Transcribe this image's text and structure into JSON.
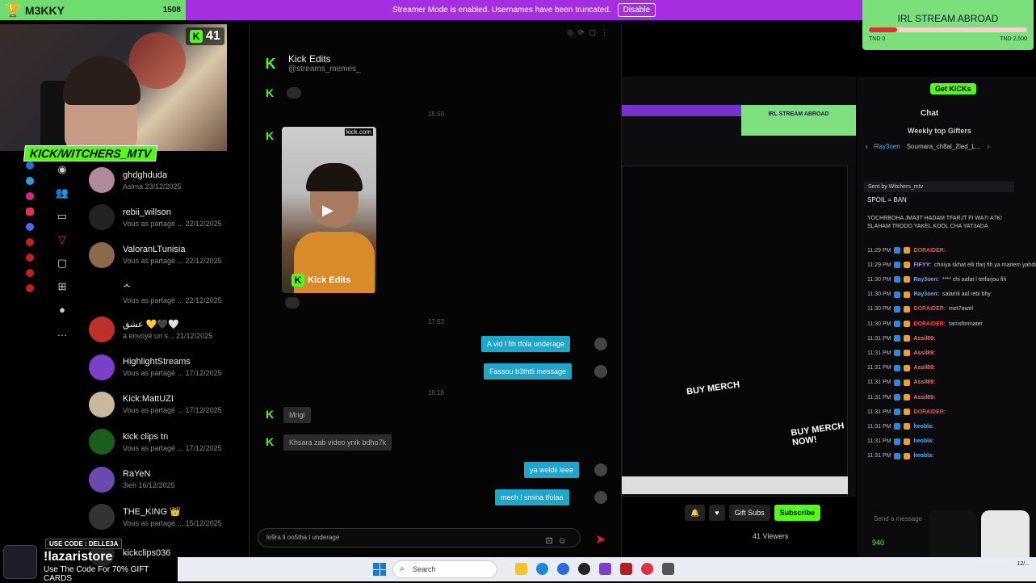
{
  "overlay": {
    "streamer_name": "M3KKY",
    "score": "1508",
    "viewer_count": "41",
    "cam_tag": "KICK/WITCHERS_MTV"
  },
  "banner": {
    "message": "Streamer Mode is enabled. Usernames have been truncated.",
    "disable_label": "Disable"
  },
  "goal": {
    "title": "IRL STREAM ABROAD",
    "min_label": "TND 0",
    "max_label": "TND 2,500",
    "progress_fraction": 0.18
  },
  "dm_list": [
    {
      "name": "ghdghduda",
      "sub": "Aslma 23/12/2025",
      "color": "#b08a9a"
    },
    {
      "name": "rebii_willson",
      "sub": "Vous as partagé ... 22/12/2025",
      "color": "#222"
    },
    {
      "name": "ValoranLTunisia",
      "sub": "Vous as partagé ... 22/12/2025",
      "color": "#8a6a4a"
    },
    {
      "name": "ᄉ",
      "sub": "Vous as partagé ... 22/12/2025",
      "color": "#000"
    },
    {
      "name": "عشق 💛🖤🤍",
      "sub": "a envoyé un s... 21/12/2025",
      "color": "#c0302a"
    },
    {
      "name": "HighlightStreams",
      "sub": "Vous as partagé ... 17/12/2025",
      "color": "#7b3fc8"
    },
    {
      "name": "Kick:MattUZI",
      "sub": "Vous as partagé ... 17/12/2025",
      "color": "#c8b8a0"
    },
    {
      "name": "kick clips tn",
      "sub": "Vous as partagé ... 17/12/2025",
      "color": "#1b5e1b"
    },
    {
      "name": "RaYeN",
      "sub": "3leh 16/12/2025",
      "color": "#6a4ab0"
    },
    {
      "name": "THE_KING 👑",
      "sub": "Vous as partagé ... 15/12/2025",
      "color": "#333"
    },
    {
      "name": "kickclips036",
      "sub": "",
      "color": "#222"
    }
  ],
  "chat": {
    "header_name": "Kick Edits",
    "header_handle": "@streams_memes_",
    "time1": "15:50",
    "video_caption": "Kick Edits",
    "video_top_label": "kick.com",
    "time2": "17:53",
    "time3": "18:18",
    "out1": "A vid l fih tfola underage",
    "out2": "Fassou b3thtli message",
    "in1": "Mrigl",
    "in2": "Khsara zab video ynik bdho7k",
    "out3": "ya weldii leee",
    "out4": "mech l smina tfolaa",
    "input_value": "lo9ra li oo5tha l underage"
  },
  "share": {
    "merch_text": "BUY MERCH",
    "merch_text2": "BUY MERCH NOW!"
  },
  "rchat": {
    "get_kicks": "Get KICKs",
    "chat_title": "Chat",
    "weekly": "Weekly top Gifters",
    "gifter1": "Ray3oen",
    "gifter2": "Soumara_ch8al_Zied_L...",
    "sent_by": "Sent by Witchers_mtv",
    "spoil": "SPOIL = BAN",
    "body": "YOCHRBOHA JMA3T HADAM TFARJT FI WA7I A7K! SLAHAM TRODO YAKEL KOOL CHA YAT3ada",
    "messages": [
      {
        "time": "11:29 PM",
        "user": "DORAIDER:",
        "text": "",
        "color": "#ff4a4a"
      },
      {
        "time": "11:29 PM",
        "user": "FIFYY:",
        "text": "chniya skhat elli tfarj fih ya mariem yahdik",
        "color": "#c08aff"
      },
      {
        "time": "11:30 PM",
        "user": "Ray3oen:",
        "text": "**** chi aafat l tetfarjou fih",
        "color": "#4ab0ff"
      },
      {
        "time": "11:30 PM",
        "user": "Ray3oen:",
        "text": "salamli aal rebi bhy",
        "color": "#4ab0ff"
      },
      {
        "time": "11:30 PM",
        "user": "DORAIDER:",
        "text": "met7awel",
        "color": "#ff4a4a"
      },
      {
        "time": "11:30 PM",
        "user": "DORAIDER:",
        "text": "tarnsformater",
        "color": "#ff4a4a"
      },
      {
        "time": "11:31 PM",
        "user": "Assil89:",
        "text": "",
        "color": "#ff6a6a"
      },
      {
        "time": "11:31 PM",
        "user": "Assil89:",
        "text": "",
        "color": "#ff6a6a"
      },
      {
        "time": "11:31 PM",
        "user": "Assil89:",
        "text": "",
        "color": "#ff6a6a"
      },
      {
        "time": "11:31 PM",
        "user": "Assil89:",
        "text": "",
        "color": "#ff6a6a"
      },
      {
        "time": "11:31 PM",
        "user": "Assil89:",
        "text": "",
        "color": "#ff6a6a"
      },
      {
        "time": "11:31 PM",
        "user": "DORAIDER:",
        "text": "",
        "color": "#ff4a4a"
      },
      {
        "time": "11:31 PM",
        "user": "heobla:",
        "text": "",
        "color": "#4ab0ff"
      },
      {
        "time": "11:31 PM",
        "user": "heobla:",
        "text": "",
        "color": "#4ab0ff"
      },
      {
        "time": "11:31 PM",
        "user": "heobla:",
        "text": "",
        "color": "#4ab0ff"
      }
    ],
    "gift_subs": "Gift Subs",
    "subscribe": "Subscribe",
    "viewers": "41 Viewers",
    "send_placeholder": "Send a message",
    "kick_count": "940"
  },
  "promo": {
    "code": "USE CODE : DELLE3A",
    "store": "!lazaristore",
    "use": "Use The Code For 70% GIFT CARDS"
  },
  "taskbar": {
    "search": "Search",
    "clock": "12/..."
  }
}
